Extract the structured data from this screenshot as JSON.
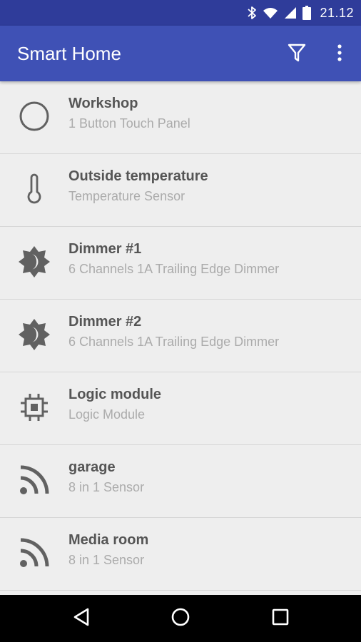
{
  "status_bar": {
    "time": "21.12",
    "icons": [
      "bluetooth-icon",
      "wifi-icon",
      "signal-icon",
      "battery-icon"
    ]
  },
  "app_bar": {
    "title": "Smart Home",
    "actions": [
      "filter-icon",
      "more-vert-icon"
    ],
    "color": "#3f51b5"
  },
  "devices": [
    {
      "name": "Workshop",
      "type": "1 Button Touch Panel",
      "icon": "circle-icon"
    },
    {
      "name": "Outside temperature",
      "type": "Temperature Sensor",
      "icon": "thermometer-icon"
    },
    {
      "name": "Dimmer #1",
      "type": "6 Channels 1A Trailing Edge Dimmer",
      "icon": "brightness-icon"
    },
    {
      "name": "Dimmer #2",
      "type": "6 Channels 1A Trailing Edge Dimmer",
      "icon": "brightness-icon"
    },
    {
      "name": "Logic module",
      "type": "Logic Module",
      "icon": "chip-icon"
    },
    {
      "name": "garage",
      "type": "8 in 1 Sensor",
      "icon": "rss-icon"
    },
    {
      "name": "Media room",
      "type": "8 in 1 Sensor",
      "icon": "rss-icon"
    }
  ],
  "nav_bar": {
    "buttons": [
      "back-icon",
      "home-icon",
      "recents-icon"
    ]
  },
  "colors": {
    "status_bar": "#2f3c9a",
    "background": "#eeeeee",
    "title_text": "#555555",
    "subtitle_text": "#ababab",
    "icon": "#616161"
  }
}
